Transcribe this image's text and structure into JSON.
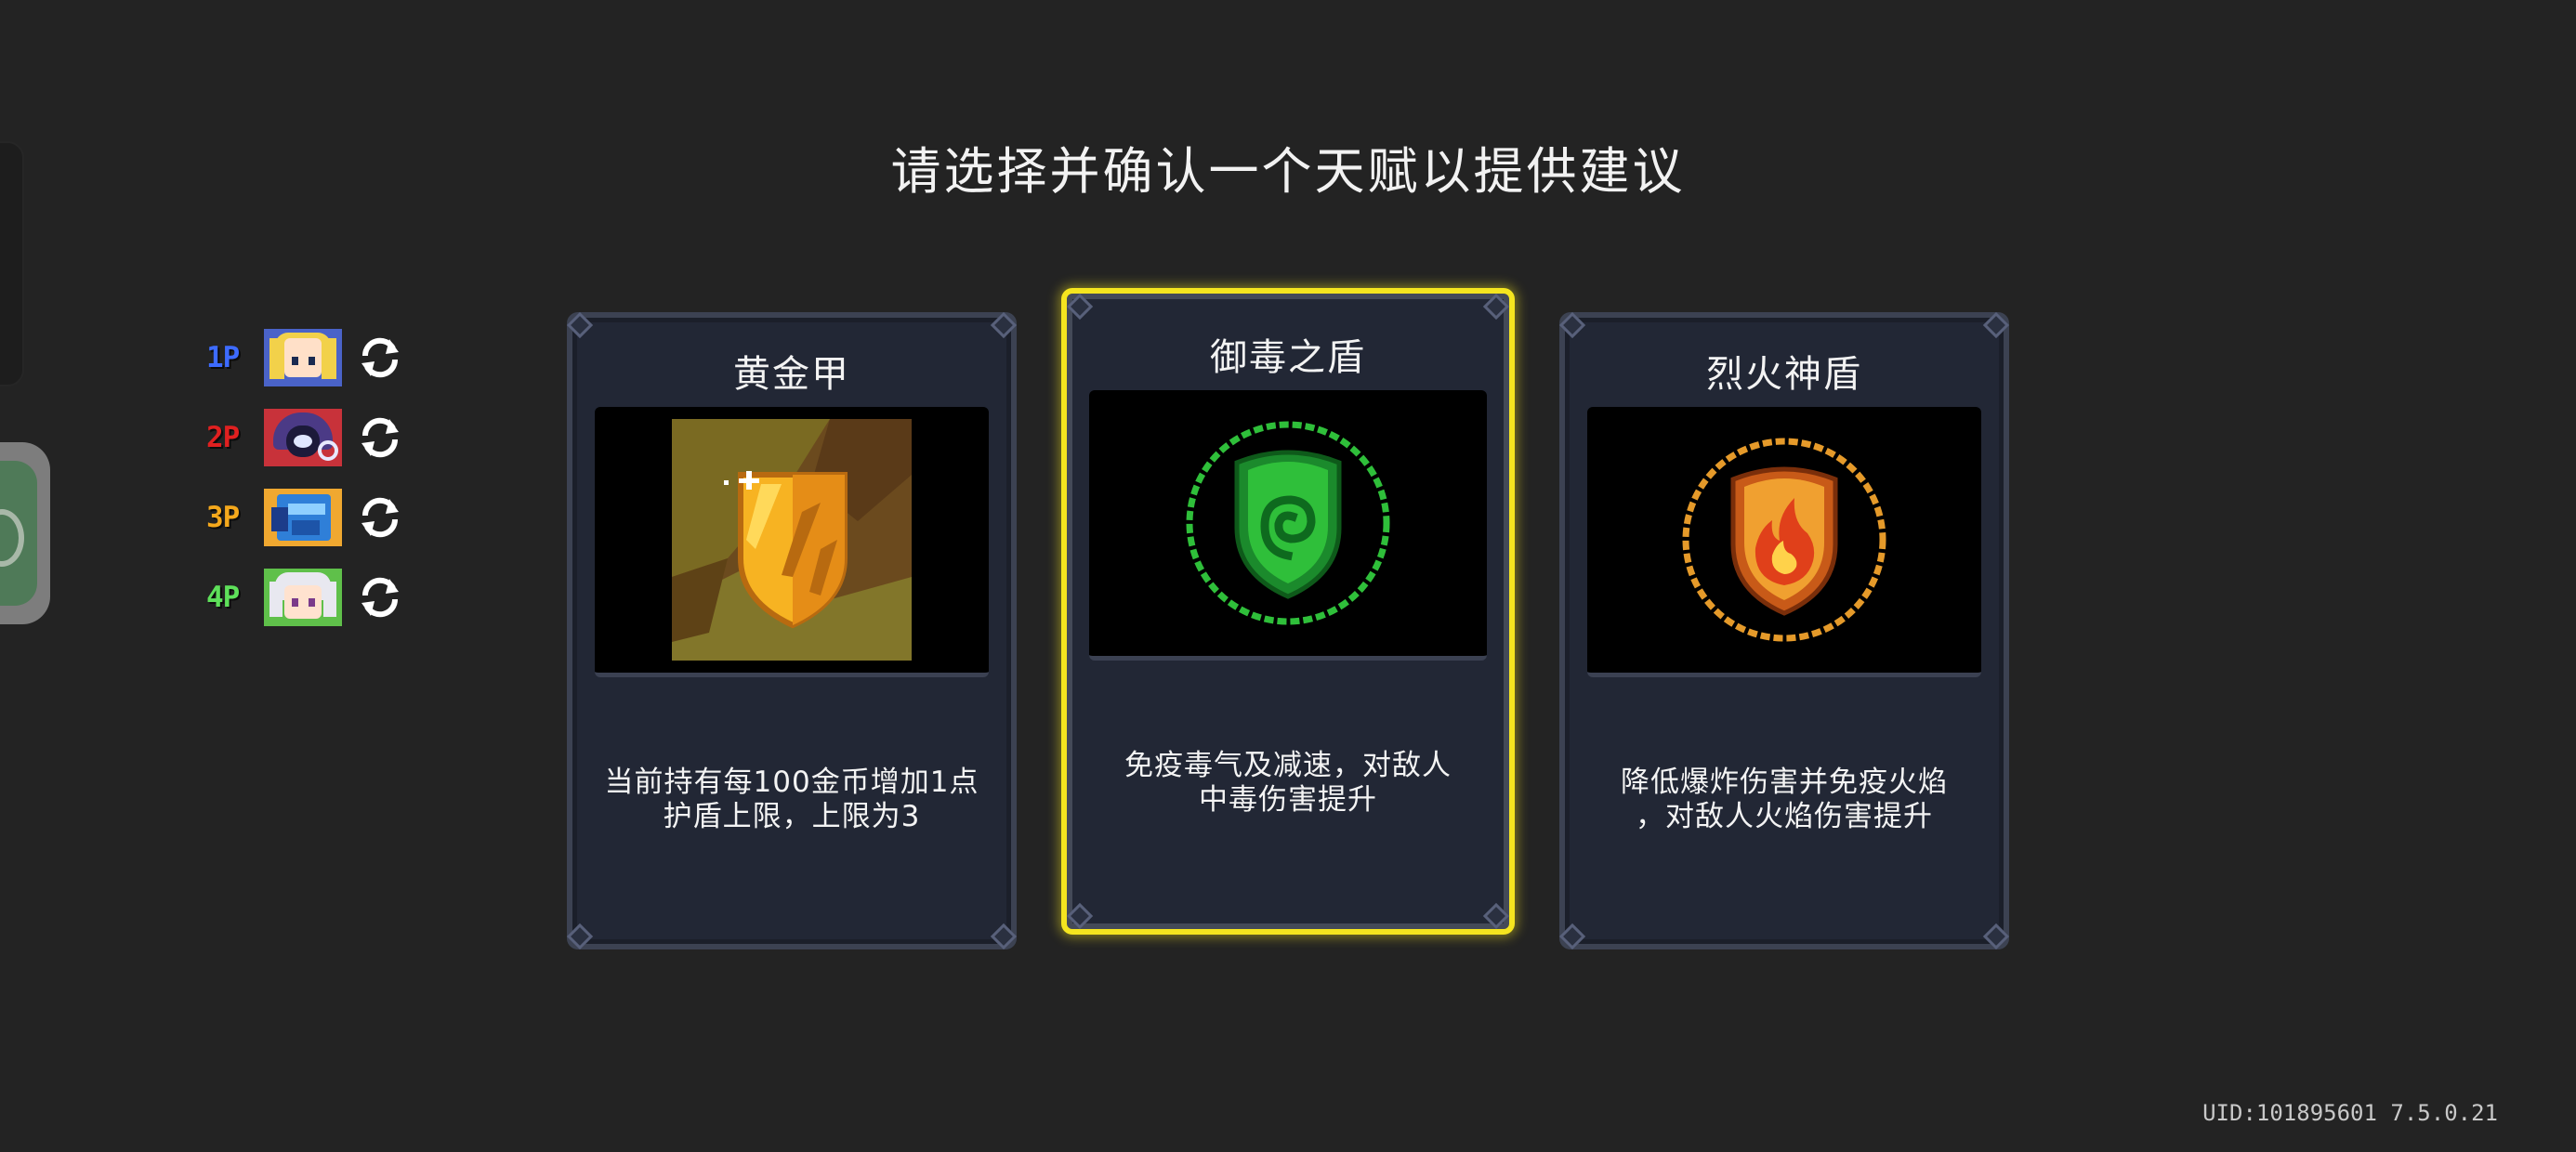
{
  "title": "请选择并确认一个天赋以提供建议",
  "players": [
    {
      "tag": "1P",
      "color": "#3d6bff",
      "avatar": "blonde-girl-avatar"
    },
    {
      "tag": "2P",
      "color": "#e02020",
      "avatar": "hooded-wizard-avatar"
    },
    {
      "tag": "3P",
      "color": "#f4a81c",
      "avatar": "blue-robot-avatar"
    },
    {
      "tag": "4P",
      "color": "#5ee05a",
      "avatar": "white-hair-avatar"
    }
  ],
  "refresh_icon": "refresh-icon",
  "cards": [
    {
      "title": "黄金甲",
      "icon": "golden-shield-icon",
      "description_line1": "当前持有每100金币增加1点",
      "description_line2": "护盾上限，上限为3",
      "selected": false
    },
    {
      "title": "御毒之盾",
      "icon": "poison-shield-icon",
      "description_line1": "免疫毒气及减速，对敌人",
      "description_line2": "中毒伤害提升",
      "selected": true
    },
    {
      "title": "烈火神盾",
      "icon": "fire-shield-icon",
      "description_line1": "降低爆炸伤害并免疫火焰",
      "description_line2": "，对敌人火焰伤害提升",
      "selected": false
    }
  ],
  "colors": {
    "background": "#232323",
    "selected_border": "#f5e51f",
    "card_bg": "#222735"
  },
  "uid_text": "UID:101895601 7.5.0.21"
}
